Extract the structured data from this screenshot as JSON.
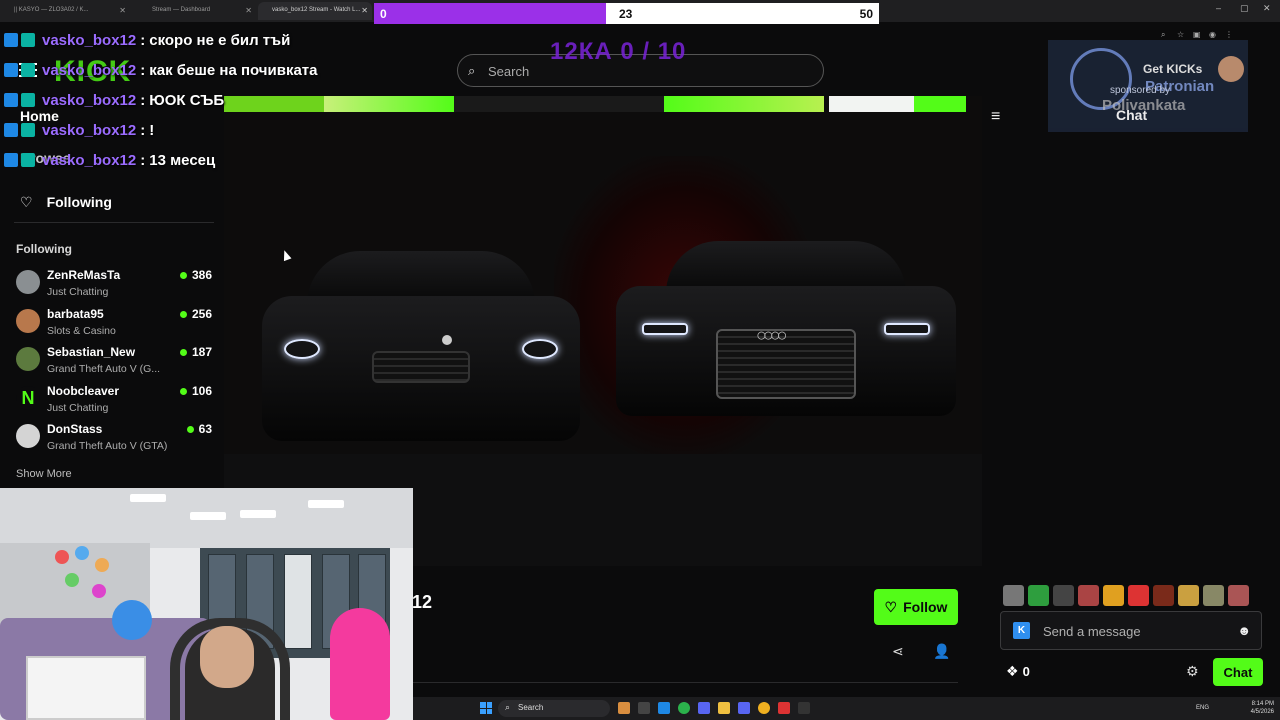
{
  "browser": {
    "tabs": [
      {
        "title": "|| KASYO — ZLO3A02 / K..."
      },
      {
        "title": "Stream — Dashboard"
      },
      {
        "title": "vasko_box12 Stream - Watch L..."
      }
    ],
    "controls": {
      "minimize": "–",
      "maximize": "▢",
      "close": "✕"
    }
  },
  "goal_bar": {
    "start": "0",
    "current": "23",
    "max": "50",
    "progress": 0.46,
    "color": "#9b30e8"
  },
  "chat_overlay": [
    {
      "user": "vasko_box12",
      "message": "скоро не е бил тъй"
    },
    {
      "user": "vasko_box12",
      "message": "как беше на почивката"
    },
    {
      "user": "vasko_box12",
      "message": "ЮОК СЪБ"
    },
    {
      "user": "vasko_box12",
      "message": "!"
    },
    {
      "user": "vasko_box12",
      "message": "13 месец"
    }
  ],
  "counter_overlay": "12КА 0 / 10",
  "header": {
    "logo": "KICK",
    "search_placeholder": "Search"
  },
  "sidebar": {
    "nav": {
      "home": "Home",
      "browse": "Browse",
      "following": "Following"
    },
    "section_title": "Following",
    "channels": [
      {
        "name": "ZenReMasTa",
        "category": "Just Chatting",
        "viewers": "386",
        "avatar_color": "#8a8f92"
      },
      {
        "name": "barbata95",
        "category": "Slots & Casino",
        "viewers": "256",
        "avatar_color": "#b8784c"
      },
      {
        "name": "Sebastian_New",
        "category": "Grand Theft Auto V (G...",
        "viewers": "187",
        "avatar_color": "#5c7a3e"
      },
      {
        "name": "Noobcleaver",
        "category": "Just Chatting",
        "viewers": "106",
        "avatar_color": "#0b0b0c"
      },
      {
        "name": "DonStass",
        "category": "Grand Theft Auto V (GTA)",
        "viewers": "63",
        "avatar_color": "#d4d4d4"
      }
    ],
    "show_more": "Show More"
  },
  "stream": {
    "name_fragment": "12",
    "follow_label": "Follow"
  },
  "patron_overlay": {
    "get_kicks": "Get KICKs",
    "sponsored": "sponsored by",
    "brand": "Patronian",
    "brand2": "Polivankata",
    "chat_label": "Chat"
  },
  "chat": {
    "input_placeholder": "Send a message",
    "kicks_count": "0",
    "send_label": "Chat",
    "emote_colors": [
      "#777",
      "#2e9e3e",
      "#444",
      "#a44",
      "#e0a020",
      "#d33",
      "#7a2a1a",
      "#caa040",
      "#886",
      "#a55"
    ]
  },
  "taskbar": {
    "search_label": "Search",
    "lang": "ENG",
    "time": "8:14 PM",
    "date": "4/5/2026"
  },
  "colors": {
    "kick_green": "#53fc18",
    "chat_purple": "#9b6cff"
  }
}
